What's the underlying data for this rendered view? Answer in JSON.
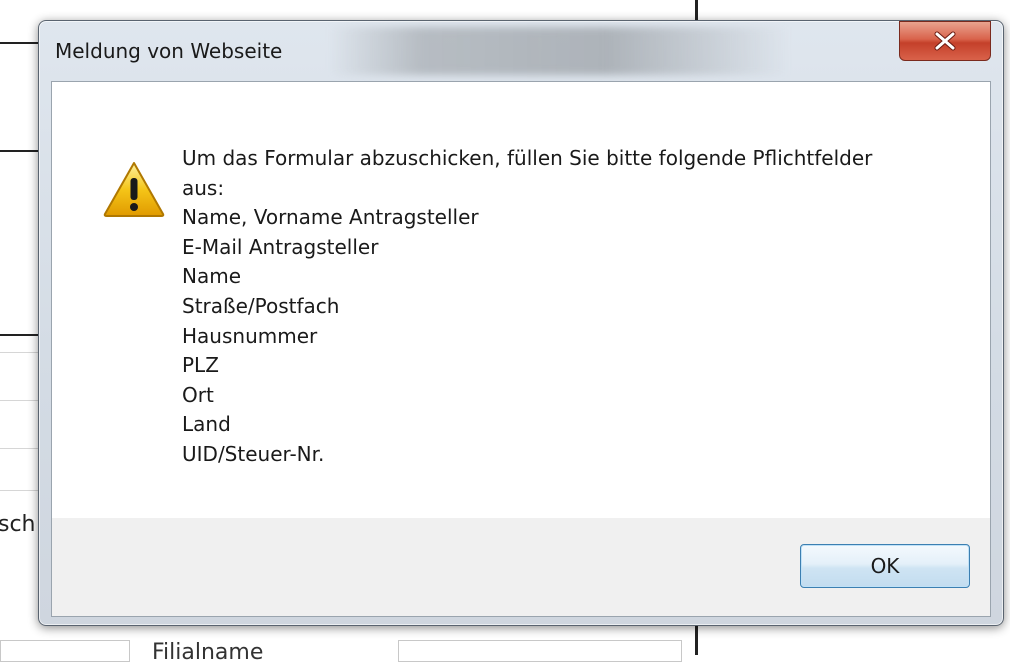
{
  "dialog": {
    "title": "Meldung von Webseite",
    "close_icon": "close-icon",
    "warning_icon": "warning-icon",
    "message_lines": [
      "Um das Formular abzuschicken, füllen Sie bitte folgende Pflichtfelder",
      "aus:",
      "Name, Vorname Antragsteller",
      "E-Mail Antragsteller",
      "Name",
      "Straße/Postfach",
      "Hausnummer",
      "PLZ",
      "Ort",
      "Land",
      "UID/Steuer-Nr."
    ],
    "ok_label": "OK"
  },
  "background": {
    "partial_text_left": "sch",
    "partial_text_bottom": "Filialname"
  },
  "colors": {
    "close_button": "#c9462f",
    "ok_button_border": "#3c7fb1",
    "warning_yellow": "#f5c518",
    "dialog_frame": "#d3dbe4"
  }
}
